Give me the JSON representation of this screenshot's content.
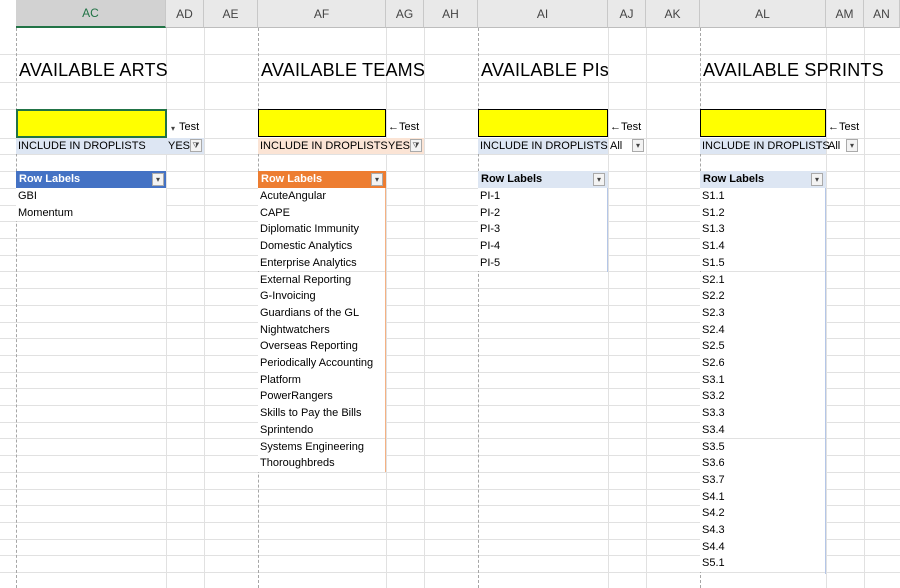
{
  "columns": [
    "AC",
    "AD",
    "AE",
    "AF",
    "AG",
    "AH",
    "AI",
    "AJ",
    "AK",
    "AL",
    "AM",
    "AN"
  ],
  "selected_column": "AC",
  "titles": {
    "arts": "AVAILABLE ARTS",
    "teams": "AVAILABLE TEAMS",
    "pis": "AVAILABLE PIs",
    "sprints": "AVAILABLE SPRINTS"
  },
  "test_labels": {
    "arts": "Test",
    "teams": "←Test",
    "pis": "←Test",
    "sprints": "←Test"
  },
  "include_label": "INCLUDE IN DROPLISTS",
  "filter_values": {
    "arts": "YES",
    "teams": "YES",
    "pis": "All",
    "sprints": "All"
  },
  "row_labels": "Row Labels",
  "colors": {
    "arts_header": "#4472c4",
    "teams_header": "#ed7d31",
    "blue_light": "#dde6f3",
    "orange_light": "#fbe4d5",
    "yellow": "#ffff00",
    "excel_green": "#217346"
  },
  "arts": [
    "GBI",
    "Momentum"
  ],
  "teams": [
    "AcuteAngular",
    "CAPE",
    "Diplomatic Immunity",
    "Domestic Analytics",
    "Enterprise Analytics",
    "External Reporting",
    "G-Invoicing",
    "Guardians of the GL",
    "Nightwatchers",
    "Overseas Reporting",
    "Periodically Accounting",
    "Platform",
    "PowerRangers",
    "Skills to Pay the Bills",
    "Sprintendo",
    "Systems Engineering",
    "Thoroughbreds"
  ],
  "pis": [
    "PI-1",
    "PI-2",
    "PI-3",
    "PI-4",
    "PI-5"
  ],
  "sprints": [
    "S1.1",
    "S1.2",
    "S1.3",
    "S1.4",
    "S1.5",
    "S2.1",
    "S2.2",
    "S2.3",
    "S2.4",
    "S2.5",
    "S2.6",
    "S3.1",
    "S3.2",
    "S3.3",
    "S3.4",
    "S3.5",
    "S3.6",
    "S3.7",
    "S4.1",
    "S4.2",
    "S4.3",
    "S4.4",
    "S5.1"
  ]
}
